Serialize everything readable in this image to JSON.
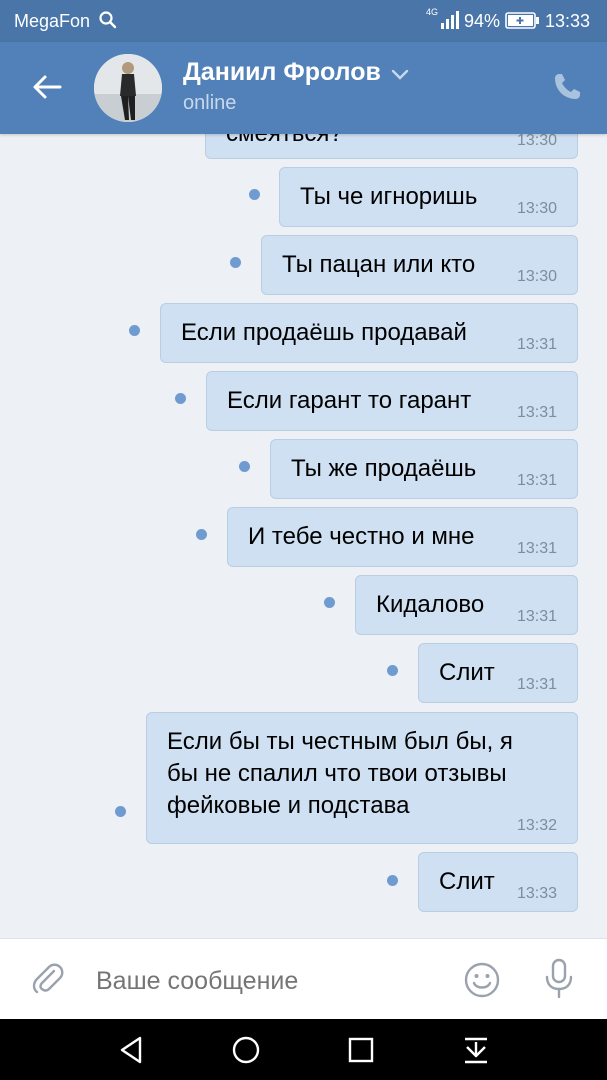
{
  "status_bar": {
    "carrier": "MegaFon",
    "network": "4G",
    "battery": "94%",
    "time": "13:33",
    "icons": [
      "search-icon",
      "signal-icon",
      "battery-icon"
    ]
  },
  "header": {
    "contact_name": "Даниил Фролов",
    "status": "online",
    "icons": [
      "back-arrow-icon",
      "chevron-down-icon",
      "phone-icon"
    ]
  },
  "messages": [
    {
      "text": "смеяться?",
      "time": "13:30"
    },
    {
      "text": "Ты че игноришь",
      "time": "13:30"
    },
    {
      "text": "Ты пацан или кто",
      "time": "13:30"
    },
    {
      "text": "Если продаёшь продавай",
      "time": "13:31"
    },
    {
      "text": "Если гарант то гарант",
      "time": "13:31"
    },
    {
      "text": "Ты же продаёшь",
      "time": "13:31"
    },
    {
      "text": "И тебе честно и мне",
      "time": "13:31"
    },
    {
      "text": "Кидалово",
      "time": "13:31"
    },
    {
      "text": "Слит",
      "time": "13:31"
    },
    {
      "text": "Если бы ты честным был бы, я\nбы не спалил что твои отзывы\nфейковые и подстава",
      "time": "13:32"
    },
    {
      "text": "Слит",
      "time": "13:33"
    }
  ],
  "composer": {
    "placeholder": "Ваше сообщение",
    "icons": [
      "attach-icon",
      "emoji-icon",
      "microphone-icon"
    ]
  },
  "nav_bar": {
    "icons": [
      "back-triangle-icon",
      "home-circle-icon",
      "recents-square-icon",
      "notification-pull-icon"
    ]
  },
  "colors": {
    "status_bar": "#4a75a9",
    "header": "#5181b8",
    "chat_background": "#edf0f4",
    "bubble": "#cfe0f2",
    "unread_dot": "#6f9bd0"
  }
}
